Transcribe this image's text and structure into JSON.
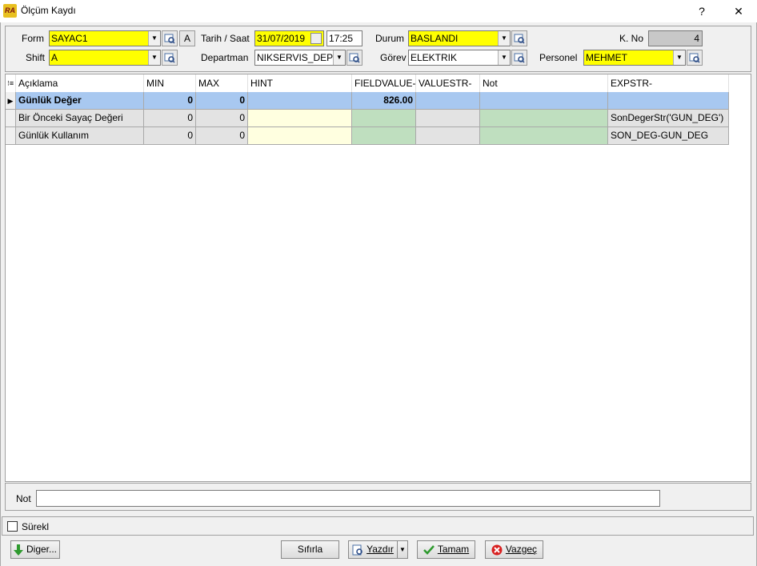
{
  "window": {
    "title": "Ölçüm Kaydı",
    "help": "?",
    "close": "✕",
    "app_badge": "RA"
  },
  "form": {
    "form_label": "Form",
    "form_value": "SAYAC1",
    "a_button": "A",
    "shift_label": "Shift",
    "shift_value": "A",
    "tarih_label": "Tarih / Saat",
    "tarih_value": "31/07/2019",
    "saat_value": "17:25",
    "departman_label": "Departman",
    "departman_value": "NIKSERVIS_DEP",
    "durum_label": "Durum",
    "durum_value": "BASLANDI",
    "gorev_label": "Görev",
    "gorev_value": "ELEKTRIK",
    "kno_label": "K. No",
    "kno_value": "4",
    "personel_label": "Personel",
    "personel_value": "MEHMET"
  },
  "grid": {
    "columns": [
      "Açıklama",
      "MIN",
      "MAX",
      "HINT",
      "FIELDVALUE-",
      "VALUESTR-",
      "Not",
      "EXPSTR-"
    ],
    "rows": [
      {
        "aciklama": "Günlük Değer",
        "min": "0",
        "max": "0",
        "hint": "",
        "fieldvalue": "826.00",
        "valuestr": "",
        "not": "",
        "expstr": ""
      },
      {
        "aciklama": "Bir Önceki Sayaç Değeri",
        "min": "0",
        "max": "0",
        "hint": "",
        "fieldvalue": "",
        "valuestr": "",
        "not": "",
        "expstr": "SonDegerStr('GUN_DEG')"
      },
      {
        "aciklama": "Günlük Kullanım",
        "min": "0",
        "max": "0",
        "hint": "",
        "fieldvalue": "",
        "valuestr": "",
        "not": "",
        "expstr": "SON_DEG-GUN_DEG"
      }
    ]
  },
  "note": {
    "label": "Not",
    "value": ""
  },
  "surekli": {
    "label": "Sürekl",
    "checked": false
  },
  "buttons": {
    "diger": "Diger...",
    "sifirla": "Sıfırla",
    "yazdir": "Yazdır",
    "tamam": "Tamam",
    "vazgec": "Vazgeç"
  },
  "colors": {
    "required": "#ffff00",
    "selected_row": "#a8c8f0",
    "readonly_cell": "#e3e3e3",
    "editable_green": "#bfdfbf",
    "editable_yellow": "#ffffe0"
  }
}
